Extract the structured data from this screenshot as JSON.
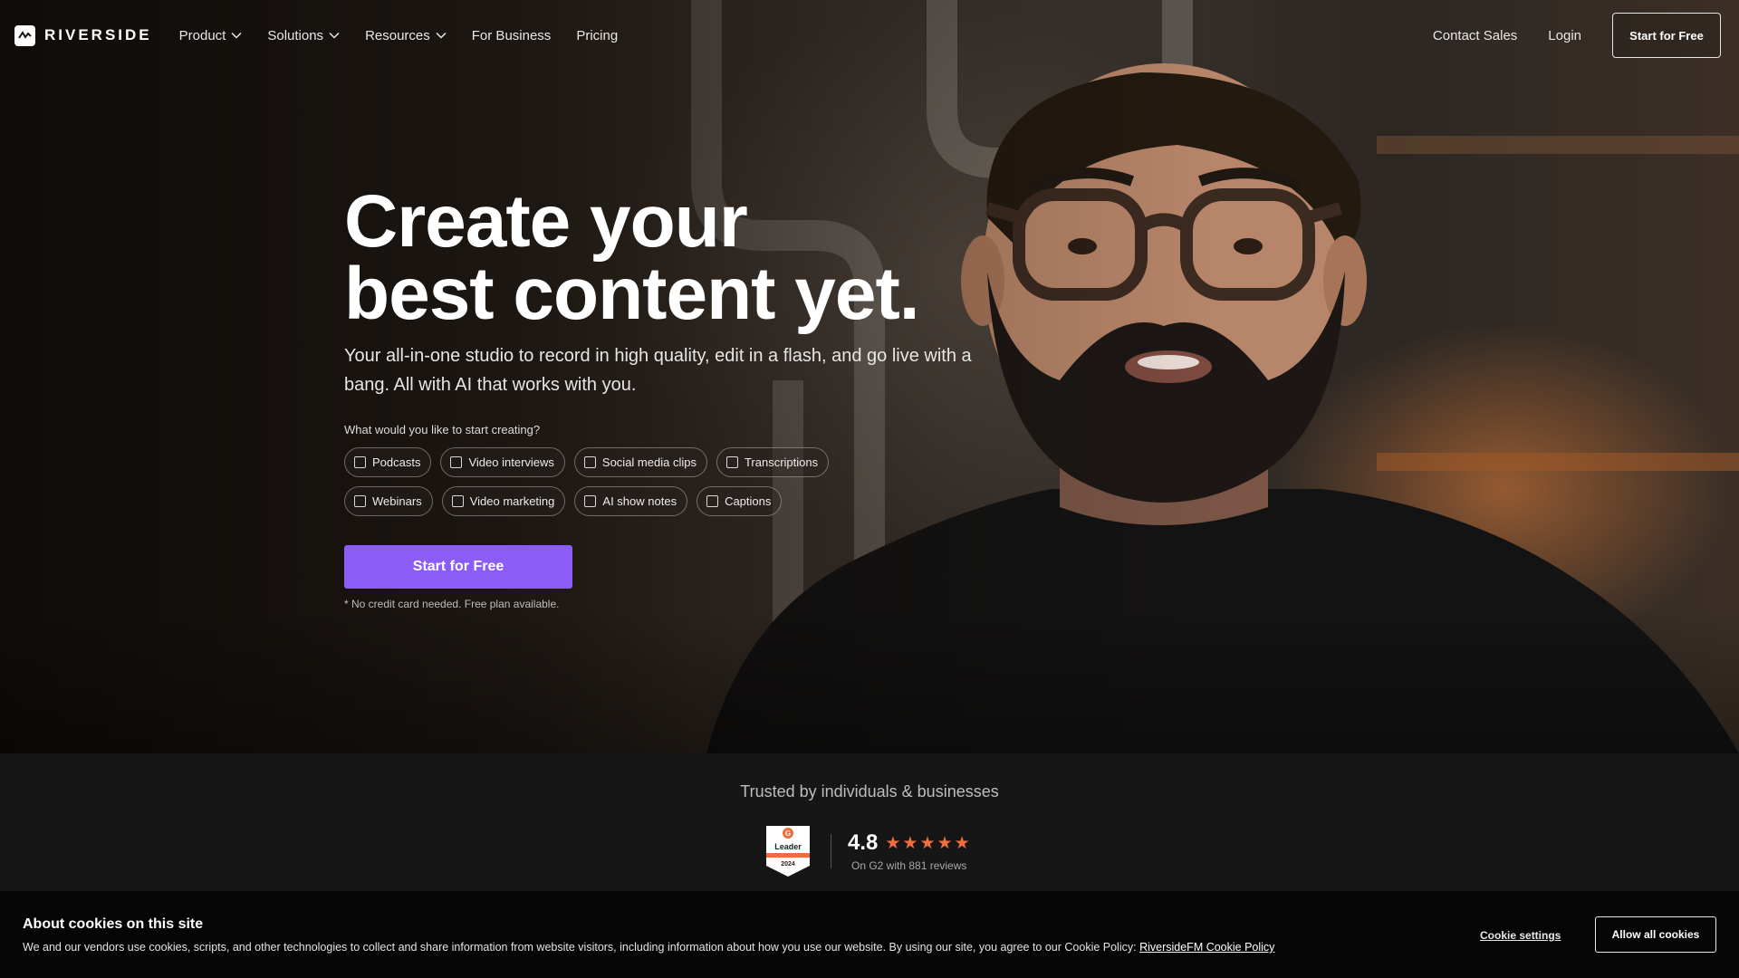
{
  "nav": {
    "logo_text": "RIVERSIDE",
    "items": [
      {
        "label": "Product",
        "dropdown": true
      },
      {
        "label": "Solutions",
        "dropdown": true
      },
      {
        "label": "Resources",
        "dropdown": true
      },
      {
        "label": "For Business",
        "dropdown": false
      },
      {
        "label": "Pricing",
        "dropdown": false
      }
    ],
    "contact_sales": "Contact Sales",
    "login": "Login",
    "cta": "Start for Free"
  },
  "hero": {
    "headline_line1": "Create your",
    "headline_line2": "best content yet.",
    "subhead": "Your all-in-one studio to record in high quality, edit in a flash, and go live with a bang. All with AI that works with you.",
    "question": "What would you like to start creating?",
    "chips_row1": [
      "Podcasts",
      "Video interviews",
      "Social media clips",
      "Transcriptions"
    ],
    "chips_row2": [
      "Webinars",
      "Video marketing",
      "AI show notes",
      "Captions"
    ],
    "cta": "Start for Free",
    "cta_note": "* No credit card needed. Free plan available."
  },
  "trust": {
    "title": "Trusted by individuals & businesses",
    "badge": {
      "label": "Leader",
      "year": "2024",
      "brand_letter": "G"
    },
    "rating": "4.8",
    "stars": 5,
    "reviews": "On G2 with 881 reviews"
  },
  "cookie": {
    "title": "About cookies on this site",
    "text": "We and our vendors use cookies, scripts, and other technologies to collect and share information from website visitors, including information about how you use our website. By using our site, you agree to our Cookie Policy:",
    "link": "RiversideFM Cookie Policy",
    "settings": "Cookie settings",
    "allow": "Allow all cookies"
  },
  "colors": {
    "accent": "#8b5cf6",
    "star": "#f06d3e",
    "g2_orange": "#f26b38",
    "background": "#161616"
  }
}
